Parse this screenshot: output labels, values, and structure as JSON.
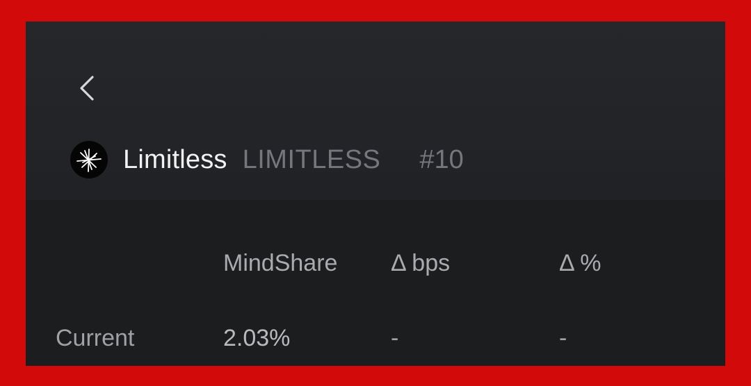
{
  "token": {
    "name": "Limitless",
    "ticker": "LIMITLESS",
    "rank": "#10",
    "logo_icon": "limitless-starburst-logo"
  },
  "nav": {
    "back_icon": "chevron-left-icon"
  },
  "table": {
    "headers": [
      "MindShare",
      "Δ bps",
      "Δ %"
    ],
    "rows": [
      {
        "label": "Current",
        "mindshare": "2.03%",
        "delta_bps": "-",
        "delta_pct": "-"
      }
    ]
  },
  "colors": {
    "border": "#d20a0a",
    "background": "#1d1e21",
    "primary_text": "#f2f2f2",
    "muted_text": "#75777c"
  }
}
